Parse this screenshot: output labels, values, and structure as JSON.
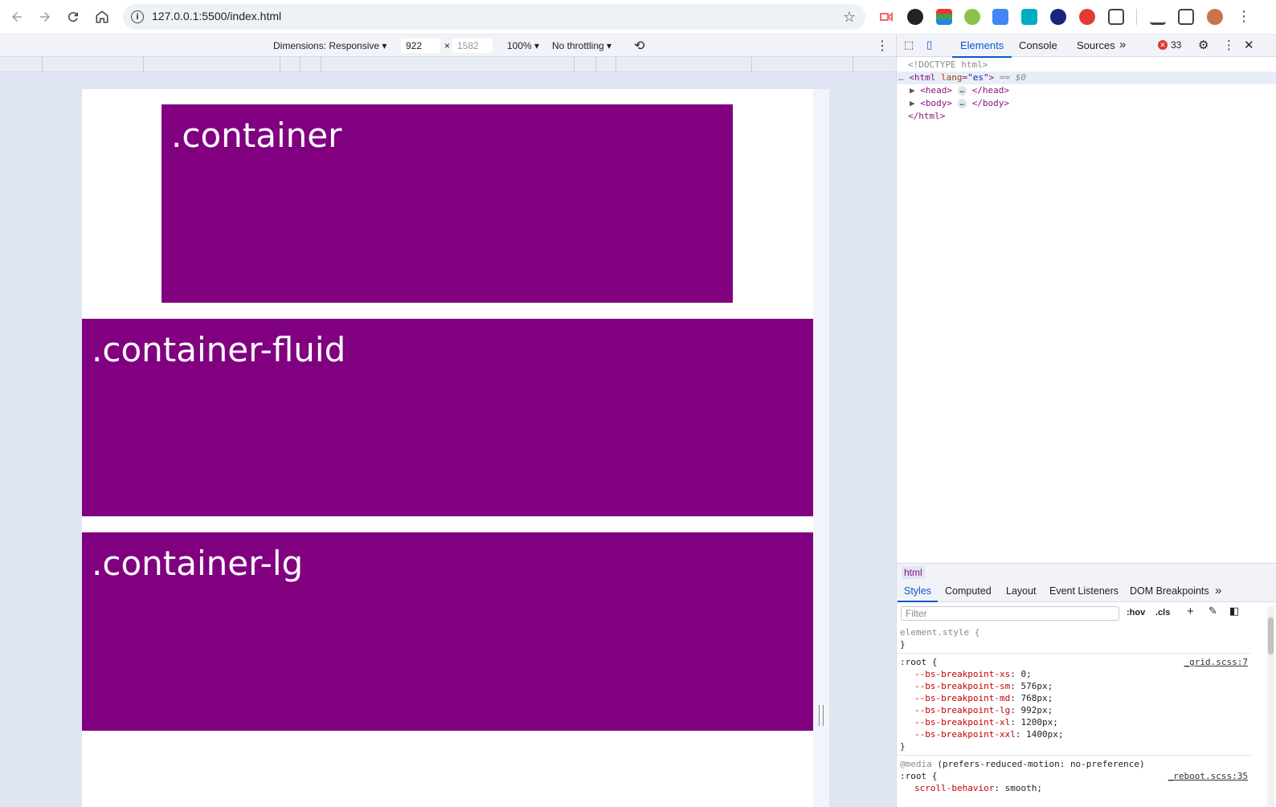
{
  "browser": {
    "url": "127.0.0.1:5500/index.html",
    "buttons": {
      "back": "Back",
      "forward": "Forward",
      "reload": "Reload",
      "home": "Home"
    }
  },
  "device_toolbar": {
    "dimensions_label": "Dimensions: Responsive",
    "width": "922",
    "times": "×",
    "height_placeholder": "1582",
    "zoom": "100%",
    "throttling": "No throttling"
  },
  "page": {
    "blocks": [
      {
        "label": ".container"
      },
      {
        "label": ".container-fluid"
      },
      {
        "label": ".container-lg"
      }
    ],
    "block_color": "#800080"
  },
  "devtools": {
    "tabs": [
      "Elements",
      "Console",
      "Sources"
    ],
    "more_tabs": "»",
    "error_count": "33",
    "dom": {
      "doctype": "<!DOCTYPE html>",
      "html_open": "<html",
      "lang_attr": "lang",
      "lang_val": "\"es\"",
      "html_close_bracket": ">",
      "selected_marker": "== $0",
      "head_open": "<head>",
      "head_close": "</head>",
      "body_open": "<body>",
      "body_close": "</body>",
      "html_close": "</html>",
      "ellipsis": "…"
    },
    "breadcrumb": "html",
    "subtabs": [
      "Styles",
      "Computed",
      "Layout",
      "Event Listeners",
      "DOM Breakpoints"
    ],
    "filter_placeholder": "Filter",
    "hov": ":hov",
    "cls": ".cls",
    "styles": {
      "element_style": "element.style {",
      "close": "}",
      "root_selector": ":root {",
      "root_source": "_grid.scss:7",
      "vars": [
        {
          "name": "--bs-breakpoint-xs",
          "value": "0;"
        },
        {
          "name": "--bs-breakpoint-sm",
          "value": "576px;"
        },
        {
          "name": "--bs-breakpoint-md",
          "value": "768px;"
        },
        {
          "name": "--bs-breakpoint-lg",
          "value": "992px;"
        },
        {
          "name": "--bs-breakpoint-xl",
          "value": "1200px;"
        },
        {
          "name": "--bs-breakpoint-xxl",
          "value": "1400px;"
        }
      ],
      "media_keyword": "@media",
      "media_query": "(prefers-reduced-motion: no-preference)",
      "root2_selector": ":root {",
      "root2_source": "_reboot.scss:35",
      "scroll_prop": "scroll-behavior",
      "scroll_val": "smooth;"
    }
  }
}
